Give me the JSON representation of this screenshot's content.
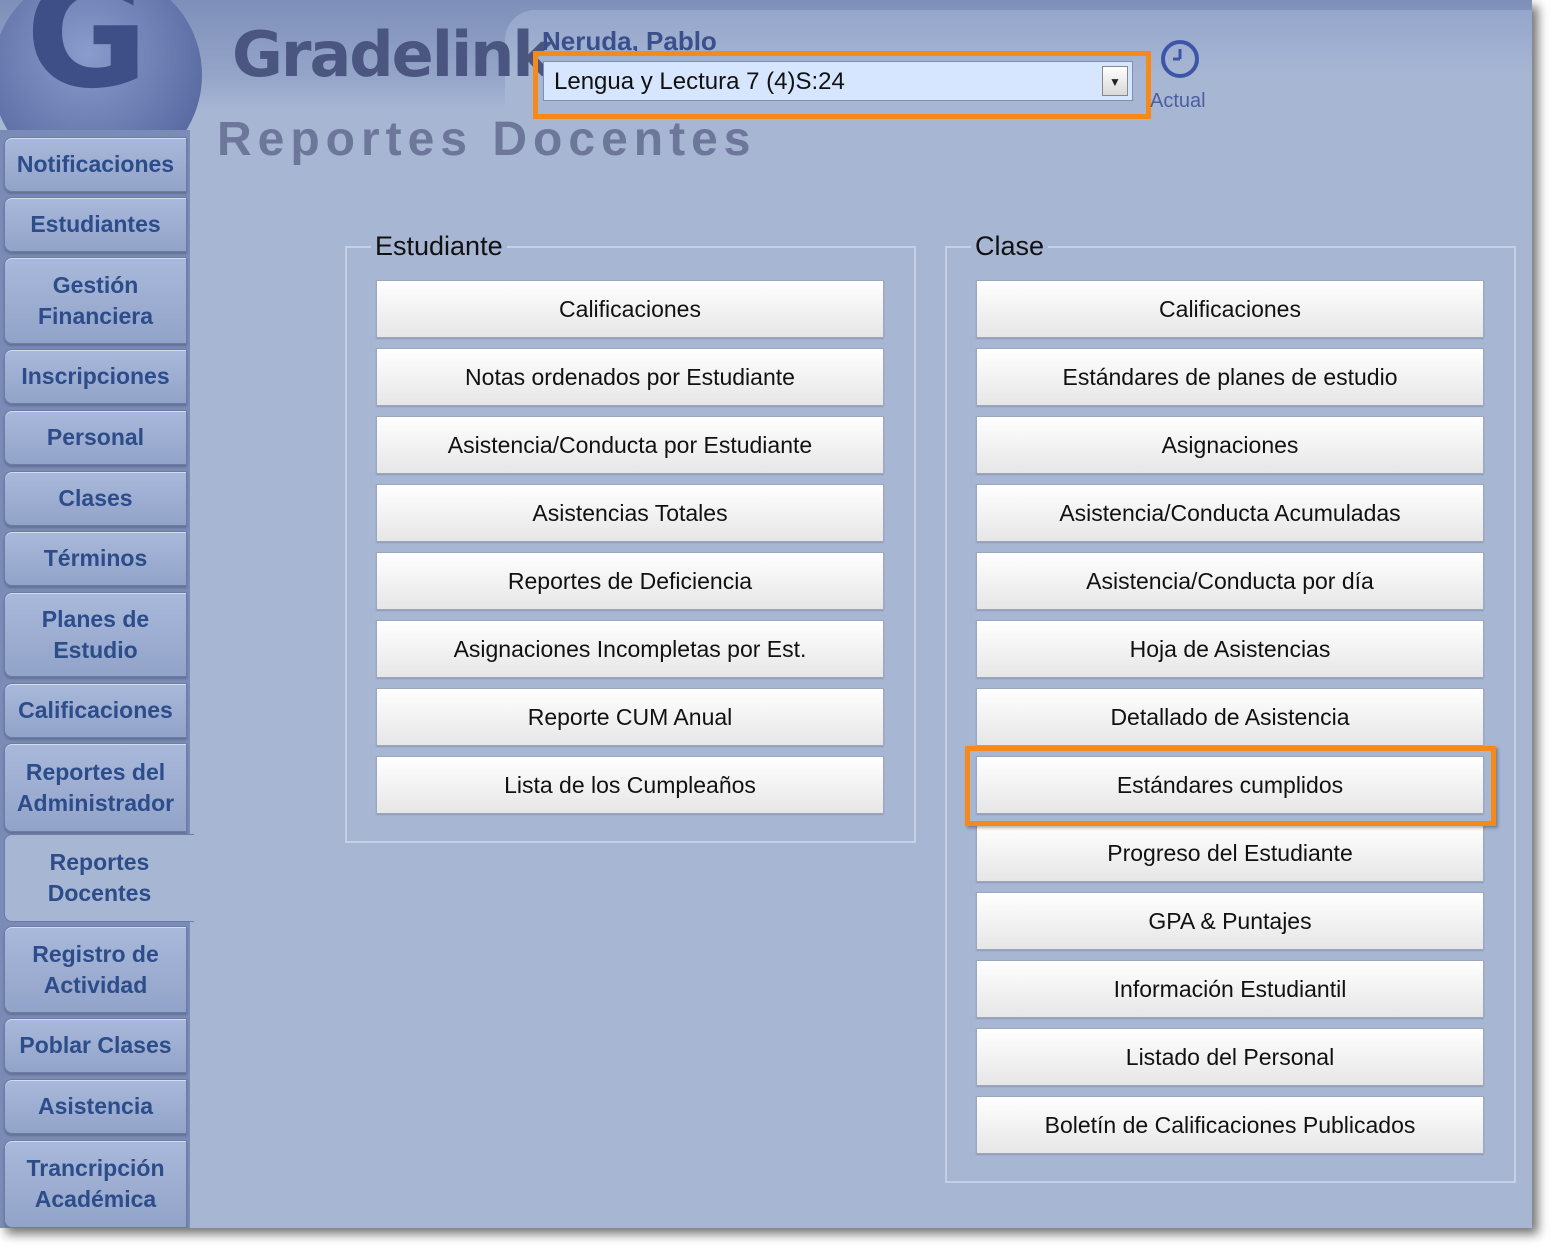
{
  "app": {
    "brand": "Gradelink"
  },
  "header": {
    "user_name": "Neruda, Pablo",
    "class_select_value": "Lengua y Lectura 7 (4)S:24",
    "current_label": "Actual"
  },
  "page_title": "Reportes Docentes",
  "sidebar": {
    "items": [
      {
        "label": "Notificaciones"
      },
      {
        "label": "Estudiantes"
      },
      {
        "label": "Gestión Financiera"
      },
      {
        "label": "Inscripciones"
      },
      {
        "label": "Personal"
      },
      {
        "label": "Clases"
      },
      {
        "label": "Términos"
      },
      {
        "label": "Planes de Estudio"
      },
      {
        "label": "Calificaciones"
      },
      {
        "label": "Reportes del Administrador"
      },
      {
        "label": "Reportes Docentes"
      },
      {
        "label": "Registro de Actividad"
      },
      {
        "label": "Poblar Clases"
      },
      {
        "label": "Asistencia"
      },
      {
        "label": "Trancripción Académica"
      }
    ],
    "active_index": 10
  },
  "student_group": {
    "legend": "Estudiante",
    "buttons": [
      "Calificaciones",
      "Notas ordenados por Estudiante",
      "Asistencia/Conducta por Estudiante",
      "Asistencias Totales",
      "Reportes de Deficiencia",
      "Asignaciones Incompletas por Est.",
      "Reporte CUM Anual",
      "Lista de los Cumpleaños"
    ]
  },
  "class_group": {
    "legend": "Clase",
    "buttons": [
      "Calificaciones",
      "Estándares de planes de estudio",
      "Asignaciones",
      "Asistencia/Conducta Acumuladas",
      "Asistencia/Conducta por día",
      "Hoja de Asistencias",
      "Detallado de Asistencia",
      "Estándares cumplidos",
      "Progreso del Estudiante",
      "GPA & Puntajes",
      "Información Estudiantil",
      "Listado del Personal",
      "Boletín de Calificaciones Publicados"
    ]
  },
  "colors": {
    "highlight": "#f58a1a",
    "nav_text": "#2c4c8a",
    "background": "#a7b6d3"
  }
}
